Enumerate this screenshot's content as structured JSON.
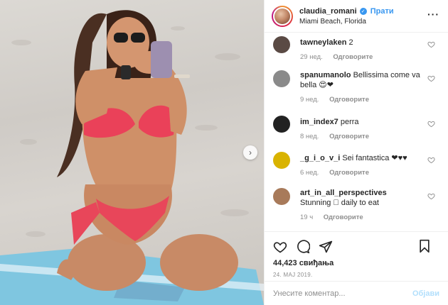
{
  "header": {
    "username": "claudia_romani",
    "follow_label": "Прати",
    "location": "Miami Beach, Florida",
    "more_icon": "more-horizontal-icon"
  },
  "comments": [
    {
      "user": "tawneylaken",
      "text": "2",
      "time": "29 нед.",
      "reply": "Одговорите",
      "avatar_color": "#5a4a44"
    },
    {
      "user": "spanumanolo",
      "text": "Bellissima come va bella 😍❤",
      "time": "9 нед.",
      "reply": "Одговорите",
      "avatar_color": "#8a8a8a"
    },
    {
      "user": "im_index7",
      "text": "perra",
      "time": "8 нед.",
      "reply": "Одговорите",
      "avatar_color": "#222222"
    },
    {
      "user": "_g_i_o_v_i",
      "text": "Sei fantastica ❤♥♥",
      "time": "6 нед.",
      "reply": "Одговорите",
      "avatar_color": "#d9b300"
    },
    {
      "user": "art_in_all_perspectives",
      "text": "Stunning 🏻 daily to eat",
      "time": "19 ч",
      "reply": "Одговорите",
      "avatar_color": "#a87a5a"
    }
  ],
  "actions": {
    "likes": "44,423 свиђања",
    "date": "24. МАЈ 2019."
  },
  "add_comment": {
    "placeholder": "Унесите коментар...",
    "post_label": "Објави"
  },
  "colors": {
    "accent": "#3897f0",
    "post_disabled": "#b2dffc",
    "meta": "#8e8e8e"
  }
}
